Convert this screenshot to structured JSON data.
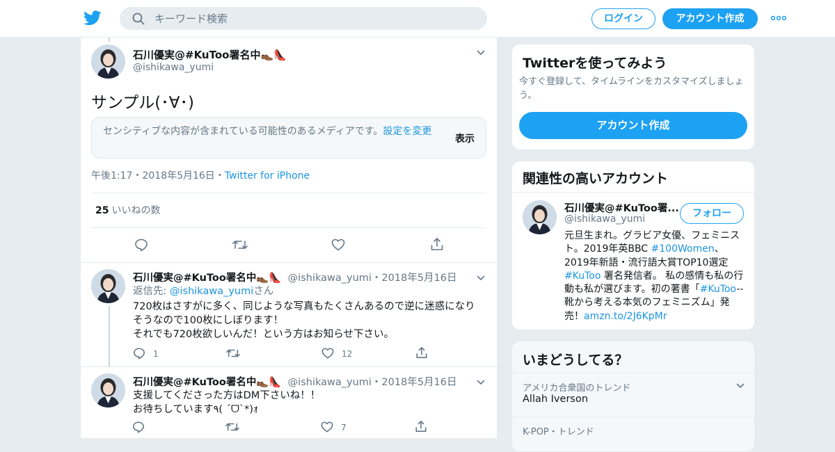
{
  "topbar": {
    "search_placeholder": "キーワード検索",
    "login_label": "ログイン",
    "signup_label": "アカウント作成",
    "brand_color": "#1da1f2"
  },
  "main_tweet": {
    "name": "石川優実@#KuToo署名中👞👠",
    "handle": "@ishikawa_yumi",
    "text": "サンプル(･∀･)",
    "sensitive_text": "センシティブな内容が含まれている可能性のあるメディアです。",
    "sensitive_link": "設定を変更",
    "sensitive_show": "表示",
    "time": "午後1:17",
    "date": "2018年5月16日",
    "source": "Twitter for iPhone",
    "likes_count": "25",
    "likes_label": "いいねの数"
  },
  "replies": [
    {
      "name": "石川優実@#KuToo署名中👞👠",
      "handle": "@ishikawa_yumi",
      "date": "2018年5月16日",
      "reply_to_label": "返信先:",
      "reply_to_handle": "@ishikawa_yumi",
      "reply_to_suffix": "さん",
      "text_lines": [
        "720枚はさすがに多く、同じような写真もたくさんあるので逆に迷惑になり",
        "そうなので100枚にしぼります！",
        "それでも720枚欲しいんだ！という方はお知らせ下さい。"
      ],
      "reply_count": "1",
      "like_count": "12"
    },
    {
      "name": "石川優実@#KuToo署名中👞👠",
      "handle": "@ishikawa_yumi",
      "date": "2018年5月16日",
      "text_lines": [
        "支援してくださった方はDM下さいね！！",
        "お待ちしています٩( ˊᗜˋ*)ｫ"
      ],
      "like_count": "7"
    }
  ],
  "sidebar": {
    "signup_card": {
      "title": "Twitterを使ってみよう",
      "subtitle": "今すぐ登録して、タイムラインをカスタマイズしましょう。",
      "button": "アカウント作成"
    },
    "related": {
      "title": "関連性の高いアカウント",
      "name": "石川優実@#KuToo署...",
      "handle": "@ishikawa_yumi",
      "follow": "フォロー",
      "bio_1": "元旦生まれ。グラビア女優、フェミニスト。2019年英BBC ",
      "bio_tag_1": "#100Women",
      "bio_2": "、2019年新語・流行語大賞TOP10選定 ",
      "bio_tag_2": "#KuToo",
      "bio_3": " 署名発信者。 私の感情も私の行動も私が選びます。初の著書「",
      "bio_tag_3": "#KuToo",
      "bio_4": "--靴から考える本気のフェミニズム」発売！",
      "bio_link": "amzn.to/2J6KpMr"
    },
    "trends": {
      "title": "いまどうしてる？",
      "items": [
        {
          "context": "アメリカ合衆国のトレンド",
          "name": "Allah Iverson"
        },
        {
          "context": "K-POP・トレンド",
          "name": ""
        }
      ]
    }
  }
}
